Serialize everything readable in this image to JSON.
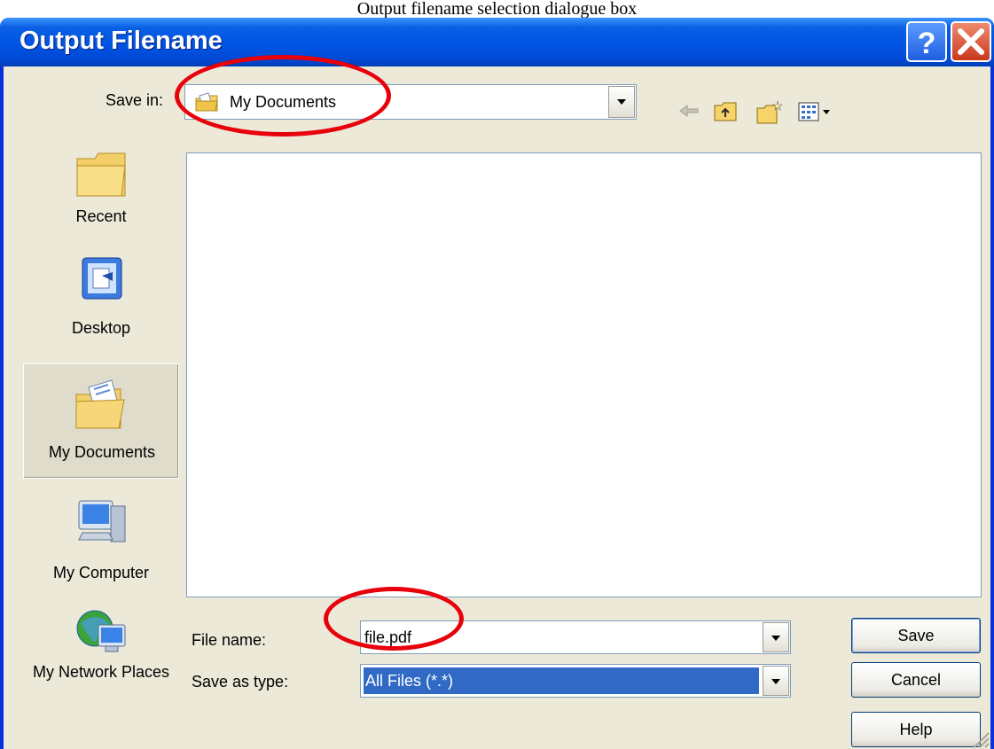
{
  "caption": "Output filename selection dialogue box",
  "window": {
    "title": "Output Filename",
    "help_icon": "help-question-icon",
    "close_icon": "close-x-icon"
  },
  "save_in": {
    "label": "Save in:",
    "value": "My Documents",
    "icon": "my-documents-folder-icon"
  },
  "toolbar": {
    "icons": [
      "back-arrow-icon",
      "up-one-level-icon",
      "new-folder-icon",
      "views-menu-icon"
    ]
  },
  "places": [
    {
      "label": "Recent",
      "icon": "recent-folder-icon",
      "selected": false
    },
    {
      "label": "Desktop",
      "icon": "desktop-icon",
      "selected": false
    },
    {
      "label": "My Documents",
      "icon": "my-documents-icon",
      "selected": true
    },
    {
      "label": "My Computer",
      "icon": "my-computer-icon",
      "selected": false
    },
    {
      "label": "My Network Places",
      "icon": "network-places-icon",
      "selected": false
    }
  ],
  "file_name": {
    "label": "File name:",
    "value": "file.pdf"
  },
  "save_as_type": {
    "label": "Save as type:",
    "value": "All Files (*.*)"
  },
  "buttons": {
    "save": "Save",
    "cancel": "Cancel",
    "help": "Help"
  },
  "colors": {
    "titlebar": "#0054e3",
    "dialog_bg": "#ece9d8",
    "selection": "#316ac5",
    "annotation": "#e8000b"
  }
}
